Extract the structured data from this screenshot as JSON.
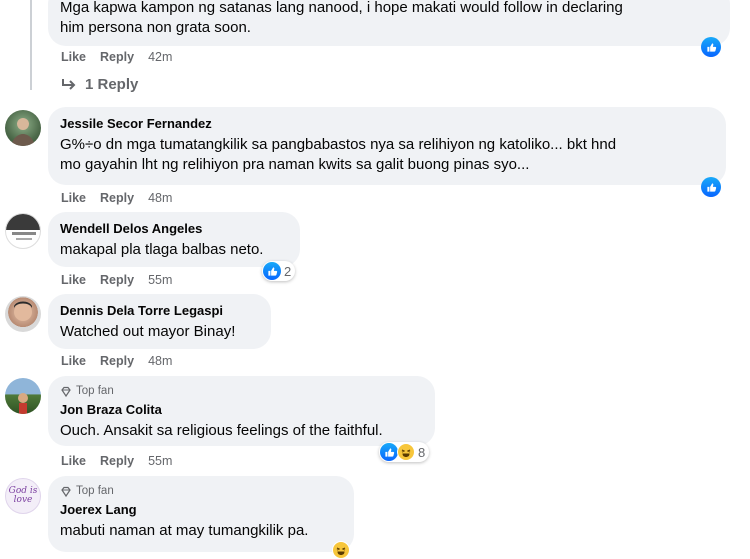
{
  "comments": [
    {
      "author": "",
      "text_lines": [
        "Mga kapwa kampon ng satanas lang nanood, i hope makati would follow in declaring",
        "him persona non grata soon."
      ],
      "like": "Like",
      "reply": "Reply",
      "time": "42m",
      "replies": "1 Reply"
    },
    {
      "author": "Jessile Secor Fernandez",
      "text_lines": [
        "G%÷o dn mga tumatangkilik sa pangbabastos nya sa relihiyon ng katoliko... bkt hnd",
        "mo gayahin lht ng relihiyon pra naman kwits sa galit buong pinas syo..."
      ],
      "like": "Like",
      "reply": "Reply",
      "time": "48m"
    },
    {
      "author": "Wendell Delos Angeles",
      "text_lines": [
        "makapal pla tlaga balbas neto."
      ],
      "like": "Like",
      "reply": "Reply",
      "time": "55m",
      "reaction_count": "2"
    },
    {
      "author": "Dennis Dela Torre Legaspi",
      "text_lines": [
        "Watched out mayor Binay!"
      ],
      "like": "Like",
      "reply": "Reply",
      "time": "48m"
    },
    {
      "author": "Jon Braza Colita",
      "badge": "Top fan",
      "text_lines": [
        "Ouch. Ansakit sa religious feelings of the faithful."
      ],
      "like": "Like",
      "reply": "Reply",
      "time": "55m",
      "reaction_count": "8"
    },
    {
      "author": "Joerex Lang",
      "badge": "Top fan",
      "text_lines": [
        "mabuti naman at may tumangkilik pa."
      ],
      "avatar_text": "God is love"
    }
  ],
  "colors": {
    "bubble": "#f0f2f5",
    "like_blue": "#0866ff",
    "meta_gray": "#65676b"
  }
}
